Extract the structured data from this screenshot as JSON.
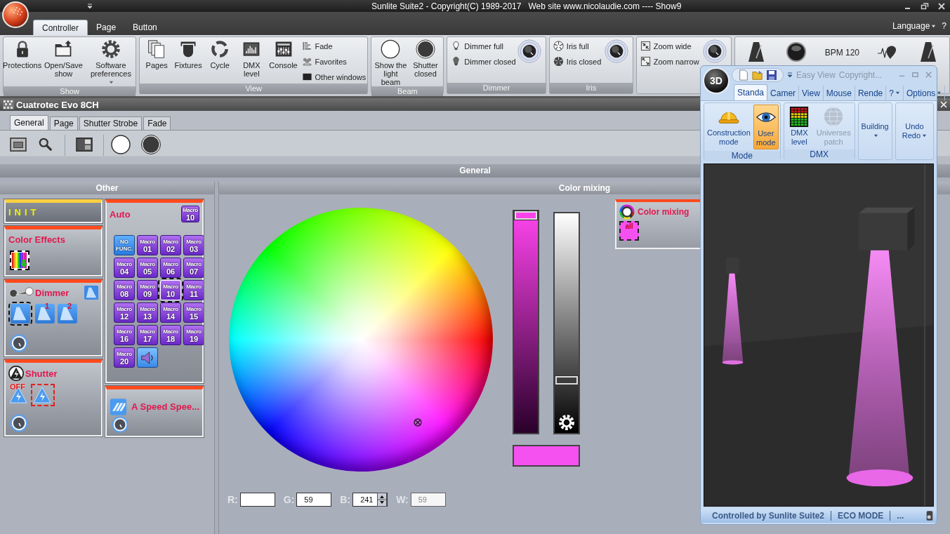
{
  "window": {
    "title": "Sunlite Suite2 - Copyright(C) 1989-2017   Web site www.nicolaudie.com ---- Show9"
  },
  "ribbon": {
    "tabs": [
      {
        "label": "Controller",
        "selected": true
      },
      {
        "label": "Page",
        "selected": false
      },
      {
        "label": "Button",
        "selected": false
      }
    ],
    "language": "Language",
    "help": "?",
    "groups": [
      {
        "label": "Show",
        "items": [
          {
            "kind": "large",
            "label": "Protections"
          },
          {
            "kind": "large",
            "label": "Open/Save show"
          },
          {
            "kind": "menu",
            "label": "Software preferences"
          }
        ]
      },
      {
        "label": "View",
        "items": [
          {
            "kind": "large",
            "label": "Pages"
          },
          {
            "kind": "large",
            "label": "Fixtures"
          },
          {
            "kind": "large",
            "label": "Cycle"
          },
          {
            "kind": "large",
            "label": "DMX level"
          },
          {
            "kind": "large",
            "label": "Console"
          },
          {
            "kind": "small",
            "label": "Fade"
          },
          {
            "kind": "small",
            "label": "Favorites"
          },
          {
            "kind": "small",
            "label": "Other windows"
          }
        ]
      },
      {
        "label": "Beam",
        "items": [
          {
            "kind": "large",
            "label": "Show the light beam"
          },
          {
            "kind": "large",
            "label": "Shutter closed"
          }
        ]
      },
      {
        "label": "Dimmer",
        "items": [
          {
            "kind": "small",
            "label": "Dimmer full"
          },
          {
            "kind": "small",
            "label": "Dimmer closed"
          },
          {
            "kind": "knob"
          }
        ]
      },
      {
        "label": "Iris",
        "items": [
          {
            "kind": "small",
            "label": "Iris full"
          },
          {
            "kind": "small",
            "label": "Iris closed"
          },
          {
            "kind": "knob"
          }
        ]
      },
      {
        "items": [
          {
            "kind": "small",
            "label": "Zoom wide"
          },
          {
            "kind": "small",
            "label": "Zoom narrow"
          },
          {
            "kind": "knob"
          }
        ]
      },
      {
        "items": [
          {
            "kind": "icon"
          },
          {
            "kind": "icon"
          },
          {
            "kind": "text",
            "label": "BPM 120"
          },
          {
            "kind": "icon"
          },
          {
            "kind": "icon"
          }
        ]
      }
    ]
  },
  "fixture_window": {
    "title": "Cuatrotec Evo 8CH",
    "tabs": [
      {
        "label": "General",
        "selected": true
      },
      {
        "label": "Page",
        "selected": false
      },
      {
        "label": "Shutter Strobe",
        "selected": false
      },
      {
        "label": "Fade",
        "selected": false
      }
    ],
    "section": "General",
    "other": {
      "title": "Other",
      "columns": [
        [
          {
            "kind": "init",
            "title": "INIT"
          },
          {
            "kind": "effects",
            "title": "Color Effects",
            "buttons": [
              {
                "selected": true
              }
            ]
          },
          {
            "kind": "dimmer",
            "title": "Dimmer",
            "buttons": [
              {
                "selected": true
              },
              {
                "badge": "1",
                "selected": false
              },
              {
                "badge": "2",
                "selected": false
              }
            ]
          },
          {
            "kind": "shutter",
            "title": "Shutter",
            "buttons": [
              {
                "badge": "OFF",
                "selected": false
              },
              {
                "selected": true
              }
            ]
          }
        ],
        [
          {
            "kind": "macros",
            "title": "Auto",
            "current": {
              "label": "Macro",
              "number": "10"
            },
            "buttons": [
              {
                "kind": "nofunc",
                "label": "NO FUNC.",
                "selected": false
              },
              {
                "kind": "macro",
                "label": "Macro",
                "number": "01",
                "selected": false
              },
              {
                "kind": "macro",
                "label": "Macro",
                "number": "02",
                "selected": false
              },
              {
                "kind": "macro",
                "label": "Macro",
                "number": "03",
                "selected": false
              },
              {
                "kind": "macro",
                "label": "Macro",
                "number": "04",
                "selected": false
              },
              {
                "kind": "macro",
                "label": "Macro",
                "number": "05",
                "selected": false
              },
              {
                "kind": "macro",
                "label": "Macro",
                "number": "06",
                "selected": false
              },
              {
                "kind": "macro",
                "label": "Macro",
                "number": "07",
                "selected": false
              },
              {
                "kind": "macro",
                "label": "Macro",
                "number": "08",
                "selected": false
              },
              {
                "kind": "macro",
                "label": "Macro",
                "number": "09",
                "selected": false
              },
              {
                "kind": "macro",
                "label": "Macro",
                "number": "10",
                "selected": true
              },
              {
                "kind": "macro",
                "label": "Macro",
                "number": "11",
                "selected": false
              },
              {
                "kind": "macro",
                "label": "Macro",
                "number": "12",
                "selected": false
              },
              {
                "kind": "macro",
                "label": "Macro",
                "number": "13",
                "selected": false
              },
              {
                "kind": "macro",
                "label": "Macro",
                "number": "14",
                "selected": false
              },
              {
                "kind": "macro",
                "label": "Macro",
                "number": "15",
                "selected": false
              },
              {
                "kind": "macro",
                "label": "Macro",
                "number": "16",
                "selected": false
              },
              {
                "kind": "macro",
                "label": "Macro",
                "number": "17",
                "selected": false
              },
              {
                "kind": "macro",
                "label": "Macro",
                "number": "18",
                "selected": false
              },
              {
                "kind": "macro",
                "label": "Macro",
                "number": "19",
                "selected": false
              },
              {
                "kind": "macro",
                "label": "Macro",
                "number": "20",
                "selected": false
              },
              {
                "kind": "sound",
                "selected": false
              }
            ]
          },
          {
            "kind": "speed",
            "title": "A Speed Spee..."
          }
        ]
      ]
    },
    "color_mixing": {
      "title": "Color mixing",
      "saturation_bar": {
        "level": 1
      },
      "brightness_bar": {
        "level": 0.23
      },
      "fields": [
        {
          "label": "R:",
          "spinner": false,
          "disabled": false
        },
        {
          "label": "G:",
          "value": "59",
          "spinner": false,
          "disabled": false
        },
        {
          "label": "B:",
          "value": "241",
          "spinner": true,
          "disabled": false
        },
        {
          "label": "W:",
          "value": "59",
          "spinner": false,
          "disabled": true
        }
      ],
      "presets": {
        "title": "Color mixing",
        "items": [
          {
            "label": "all",
            "selected": true
          }
        ]
      }
    }
  },
  "viewer": {
    "logo": "3D",
    "title": "Easy View",
    "subtitle": "Copyright...",
    "tabs": [
      {
        "kind": "tab",
        "label": "Standa",
        "selected": true
      },
      {
        "kind": "tab",
        "label": "Camer",
        "selected": false
      },
      {
        "kind": "tab",
        "label": "View",
        "selected": false
      },
      {
        "kind": "tab",
        "label": "Mouse",
        "selected": false
      },
      {
        "kind": "tab",
        "label": "Rende",
        "selected": false
      },
      {
        "kind": "menu",
        "label": "?",
        "selected": false
      },
      {
        "kind": "menu",
        "label": "Options",
        "selected": false
      }
    ],
    "groups": [
      {
        "label": "Mode",
        "items": [
          {
            "label": "Construction mode",
            "selected": false,
            "disabled": false,
            "dropdown": false
          },
          {
            "label": "User mode",
            "selected": true,
            "disabled": false,
            "dropdown": false
          }
        ]
      },
      {
        "label": "DMX",
        "items": [
          {
            "label": "DMX level",
            "selected": false,
            "disabled": false,
            "dropdown": false
          },
          {
            "label": "Universes patch",
            "selected": false,
            "disabled": true,
            "dropdown": false
          }
        ]
      },
      {
        "items": [
          {
            "label": "Building",
            "selected": false,
            "disabled": false,
            "dropdown": true
          }
        ]
      },
      {
        "items": [
          {
            "label": "Undo Redo",
            "selected": false,
            "disabled": false,
            "dropdown": true
          }
        ]
      }
    ],
    "status": [
      "Controlled by Sunlite Suite2",
      "ECO MODE",
      "..."
    ]
  }
}
